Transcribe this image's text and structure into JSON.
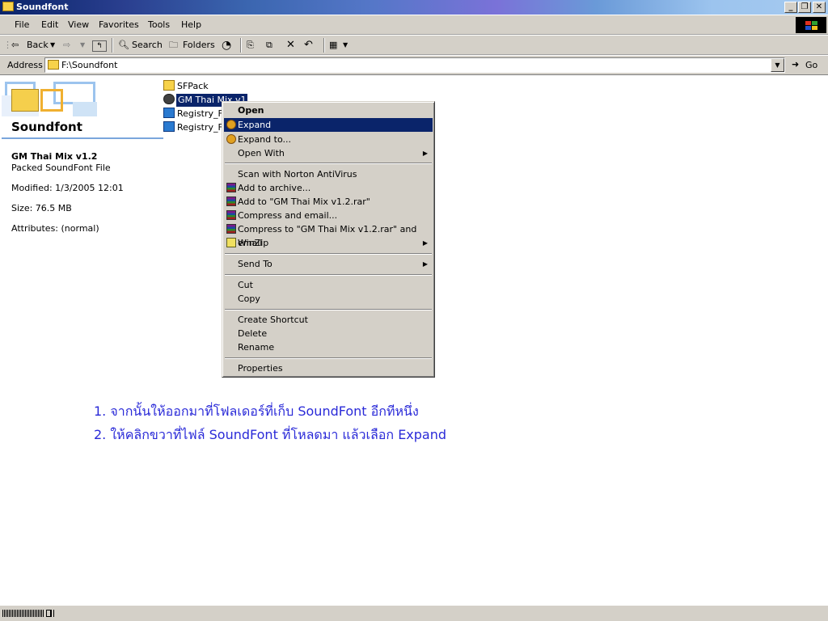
{
  "window": {
    "title": "Soundfont"
  },
  "menu": [
    "File",
    "Edit",
    "View",
    "Favorites",
    "Tools",
    "Help"
  ],
  "toolbar": {
    "back": "Back",
    "search": "Search",
    "folders": "Folders"
  },
  "address": {
    "label": "Address",
    "value": "F:\\Soundfont",
    "go": "Go"
  },
  "left_pane": {
    "folder_title": "Soundfont",
    "file_name": "GM Thai Mix v1.2",
    "file_type": "Packed SoundFont File",
    "modified": "Modified: 1/3/2005 12:01",
    "size": "Size: 76.5 MB",
    "attributes": "Attributes: (normal)"
  },
  "files": [
    "SFPack",
    "GM Thai Mix v1.2",
    "Registry_Fi",
    "Registry_Fi"
  ],
  "context_menu": {
    "open": "Open",
    "expand": "Expand",
    "expand_to": "Expand to...",
    "open_with": "Open With",
    "scan": "Scan with Norton AntiVirus",
    "add_archive": "Add to archive...",
    "add_rar": "Add to \"GM Thai Mix v1.2.rar\"",
    "compress_email": "Compress and email...",
    "compress_rar_email": "Compress to \"GM Thai Mix v1.2.rar\" and email",
    "winzip": "WinZip",
    "send_to": "Send To",
    "cut": "Cut",
    "copy": "Copy",
    "create_shortcut": "Create Shortcut",
    "delete": "Delete",
    "rename": "Rename",
    "properties": "Properties"
  },
  "instructions": [
    "1. จากนั้นให้ออกมาที่โฟลเดอร์ที่เก็บ SoundFont อีกทีหนึ่ง",
    "2. ให้คลิกขวาที่ไฟล์ SoundFont ที่โหลดมา แล้วเลือก Expand"
  ],
  "colors": {
    "selection": "#0a246a",
    "instruction_text": "#2a2ad8",
    "chrome": "#d4d0c8"
  }
}
